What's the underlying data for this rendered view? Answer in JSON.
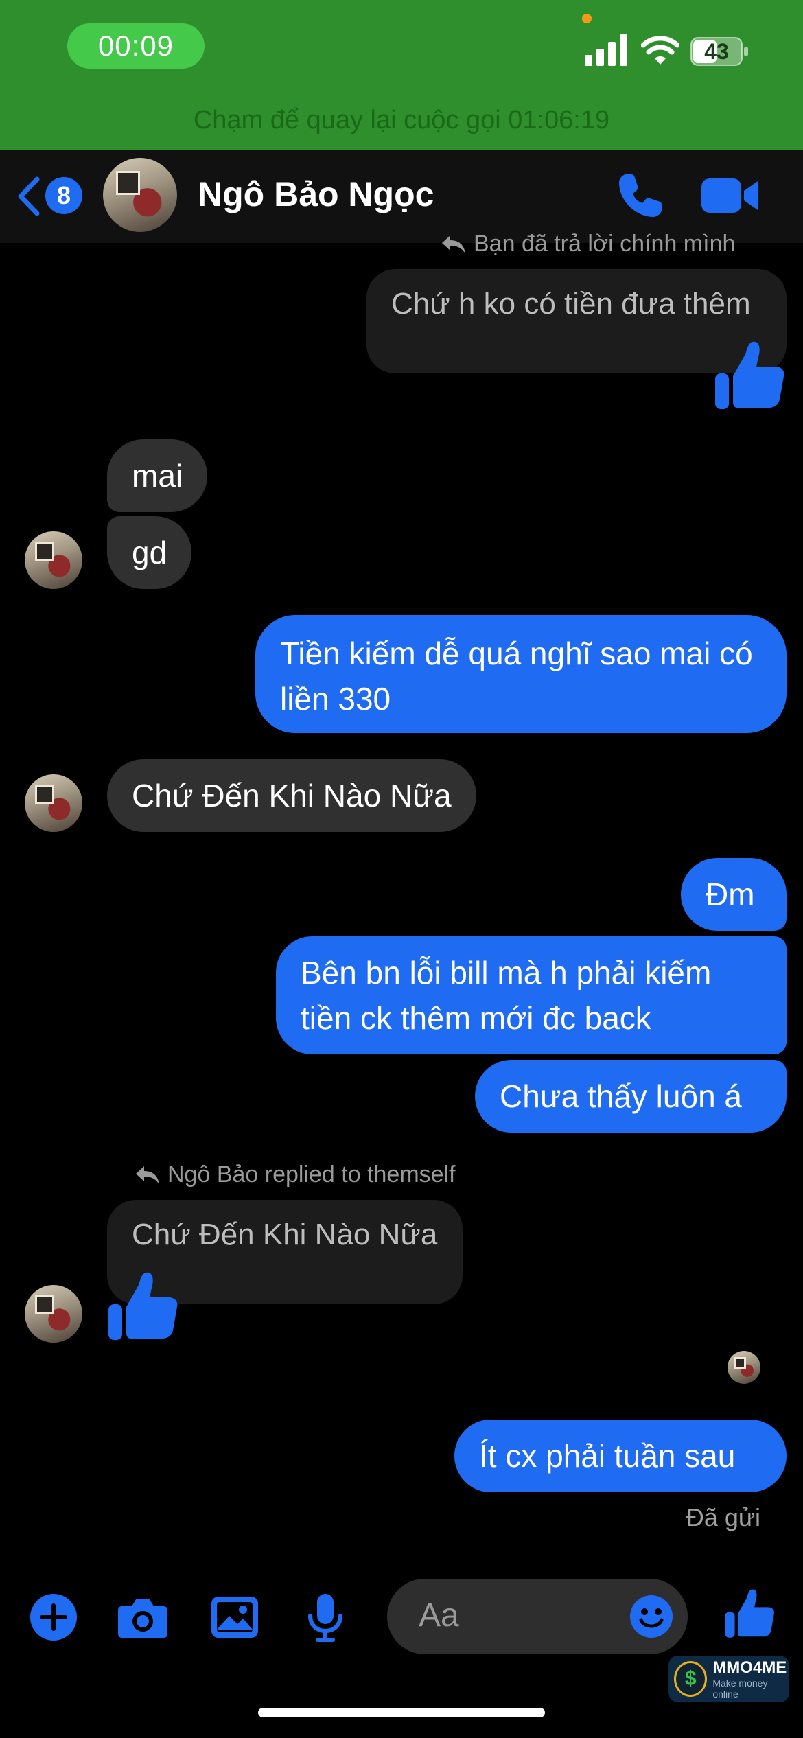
{
  "status_bar": {
    "time": "00:09",
    "battery": "43",
    "call_banner": "Chạm để quay lại cuộc gọi 01:06:19"
  },
  "header": {
    "back_count": "8",
    "contact_name": "Ngô Bảo Ngọc"
  },
  "messages": [
    {
      "id": "m1",
      "direction": "out",
      "style": "reply",
      "reply_label": "Bạn đã trả lời chính mình",
      "text": "Chứ h ko có tiền đưa thêm",
      "reaction": "like-icon"
    },
    {
      "id": "m2",
      "direction": "in",
      "text": "mai"
    },
    {
      "id": "m3",
      "direction": "in",
      "text": "gd"
    },
    {
      "id": "m4",
      "direction": "out",
      "text": "Tiền kiếm dễ quá nghĩ sao mai có liền 330"
    },
    {
      "id": "m5",
      "direction": "in",
      "text": "Chứ Đến Khi Nào Nữa"
    },
    {
      "id": "m6",
      "direction": "out",
      "text": "Đm"
    },
    {
      "id": "m7",
      "direction": "out",
      "text": "Bên bn lỗi bill mà h phải kiếm tiền ck thêm mới đc back"
    },
    {
      "id": "m8",
      "direction": "out",
      "text": "Chưa thấy luôn á"
    },
    {
      "id": "m9",
      "direction": "in",
      "style": "reply",
      "reply_label": "Ngô Bảo replied to themself",
      "text": "Chứ Đến Khi Nào Nữa",
      "reaction": "like-icon"
    },
    {
      "id": "m10",
      "direction": "out",
      "text": "Ít cx phải tuần sau"
    }
  ],
  "delivery_status": "Đã gửi",
  "composer": {
    "placeholder": "Aa"
  },
  "watermark": {
    "title": "MMO4ME",
    "subtitle": "Make money online"
  },
  "colors": {
    "accent": "#1f6cf2",
    "incoming_bubble": "#303030",
    "banner": "#2f8f2c"
  }
}
